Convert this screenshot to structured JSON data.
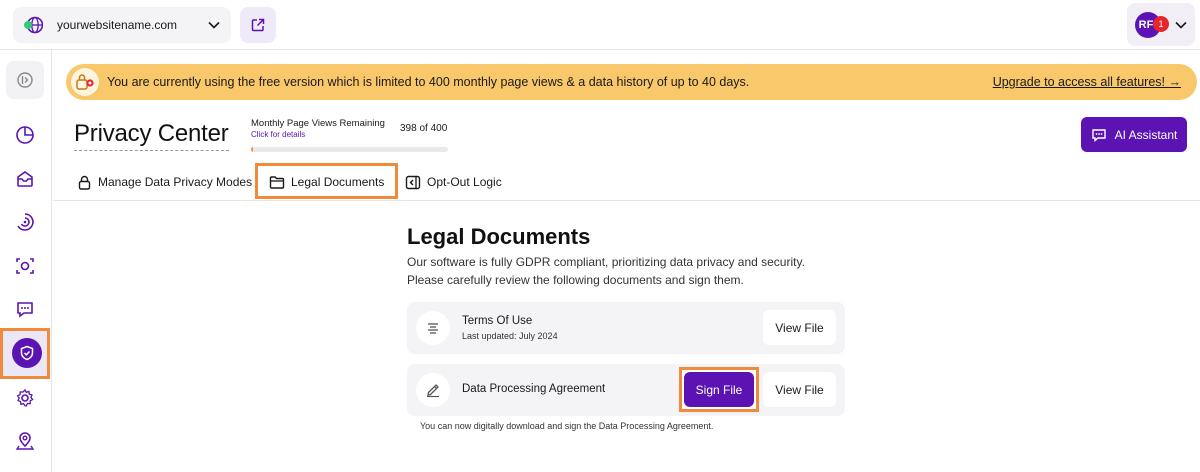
{
  "topbar": {
    "website_name": "yourwebsitename.com",
    "user_initials": "RF",
    "notification_count": "1"
  },
  "banner": {
    "text": "You are currently using the free version which is limited to 400 monthly page views & a data history of up to 40 days.",
    "link": "Upgrade to access all features! →"
  },
  "header": {
    "title": "Privacy Center",
    "page_views_label": "Monthly Page Views Remaining",
    "page_views_link": "Click for details",
    "page_views_count": "398 of 400",
    "page_views_remaining_fraction": 0.995,
    "ai_button": "AI Assistant"
  },
  "tabs": [
    {
      "label": "Manage Data Privacy Modes",
      "icon": "lock-icon"
    },
    {
      "label": "Legal Documents",
      "icon": "folder-icon",
      "active": true
    },
    {
      "label": "Opt-Out Logic",
      "icon": "opt-out-icon"
    }
  ],
  "content": {
    "title": "Legal Documents",
    "description": "Our software is fully GDPR compliant, prioritizing data privacy and security. Please carefully review the following documents and sign them.",
    "documents": [
      {
        "title": "Terms Of Use",
        "subtitle": "Last updated: July 2024",
        "view_label": "View File"
      },
      {
        "title": "Data Processing Agreement",
        "sign_label": "Sign File",
        "view_label": "View File"
      }
    ],
    "note": "You can now digitally download and sign the Data Processing Agreement."
  },
  "sidebar": {
    "items": [
      "collapse-icon",
      "dashboard-icon",
      "inbox-icon",
      "analytics-icon",
      "scan-icon",
      "chat-icon",
      "privacy-shield-icon",
      "settings-icon",
      "location-icon"
    ],
    "active": "privacy-shield-icon"
  },
  "colors": {
    "accent": "#5b14b3",
    "banner": "#f9c86a",
    "highlight": "#f08a3c"
  }
}
